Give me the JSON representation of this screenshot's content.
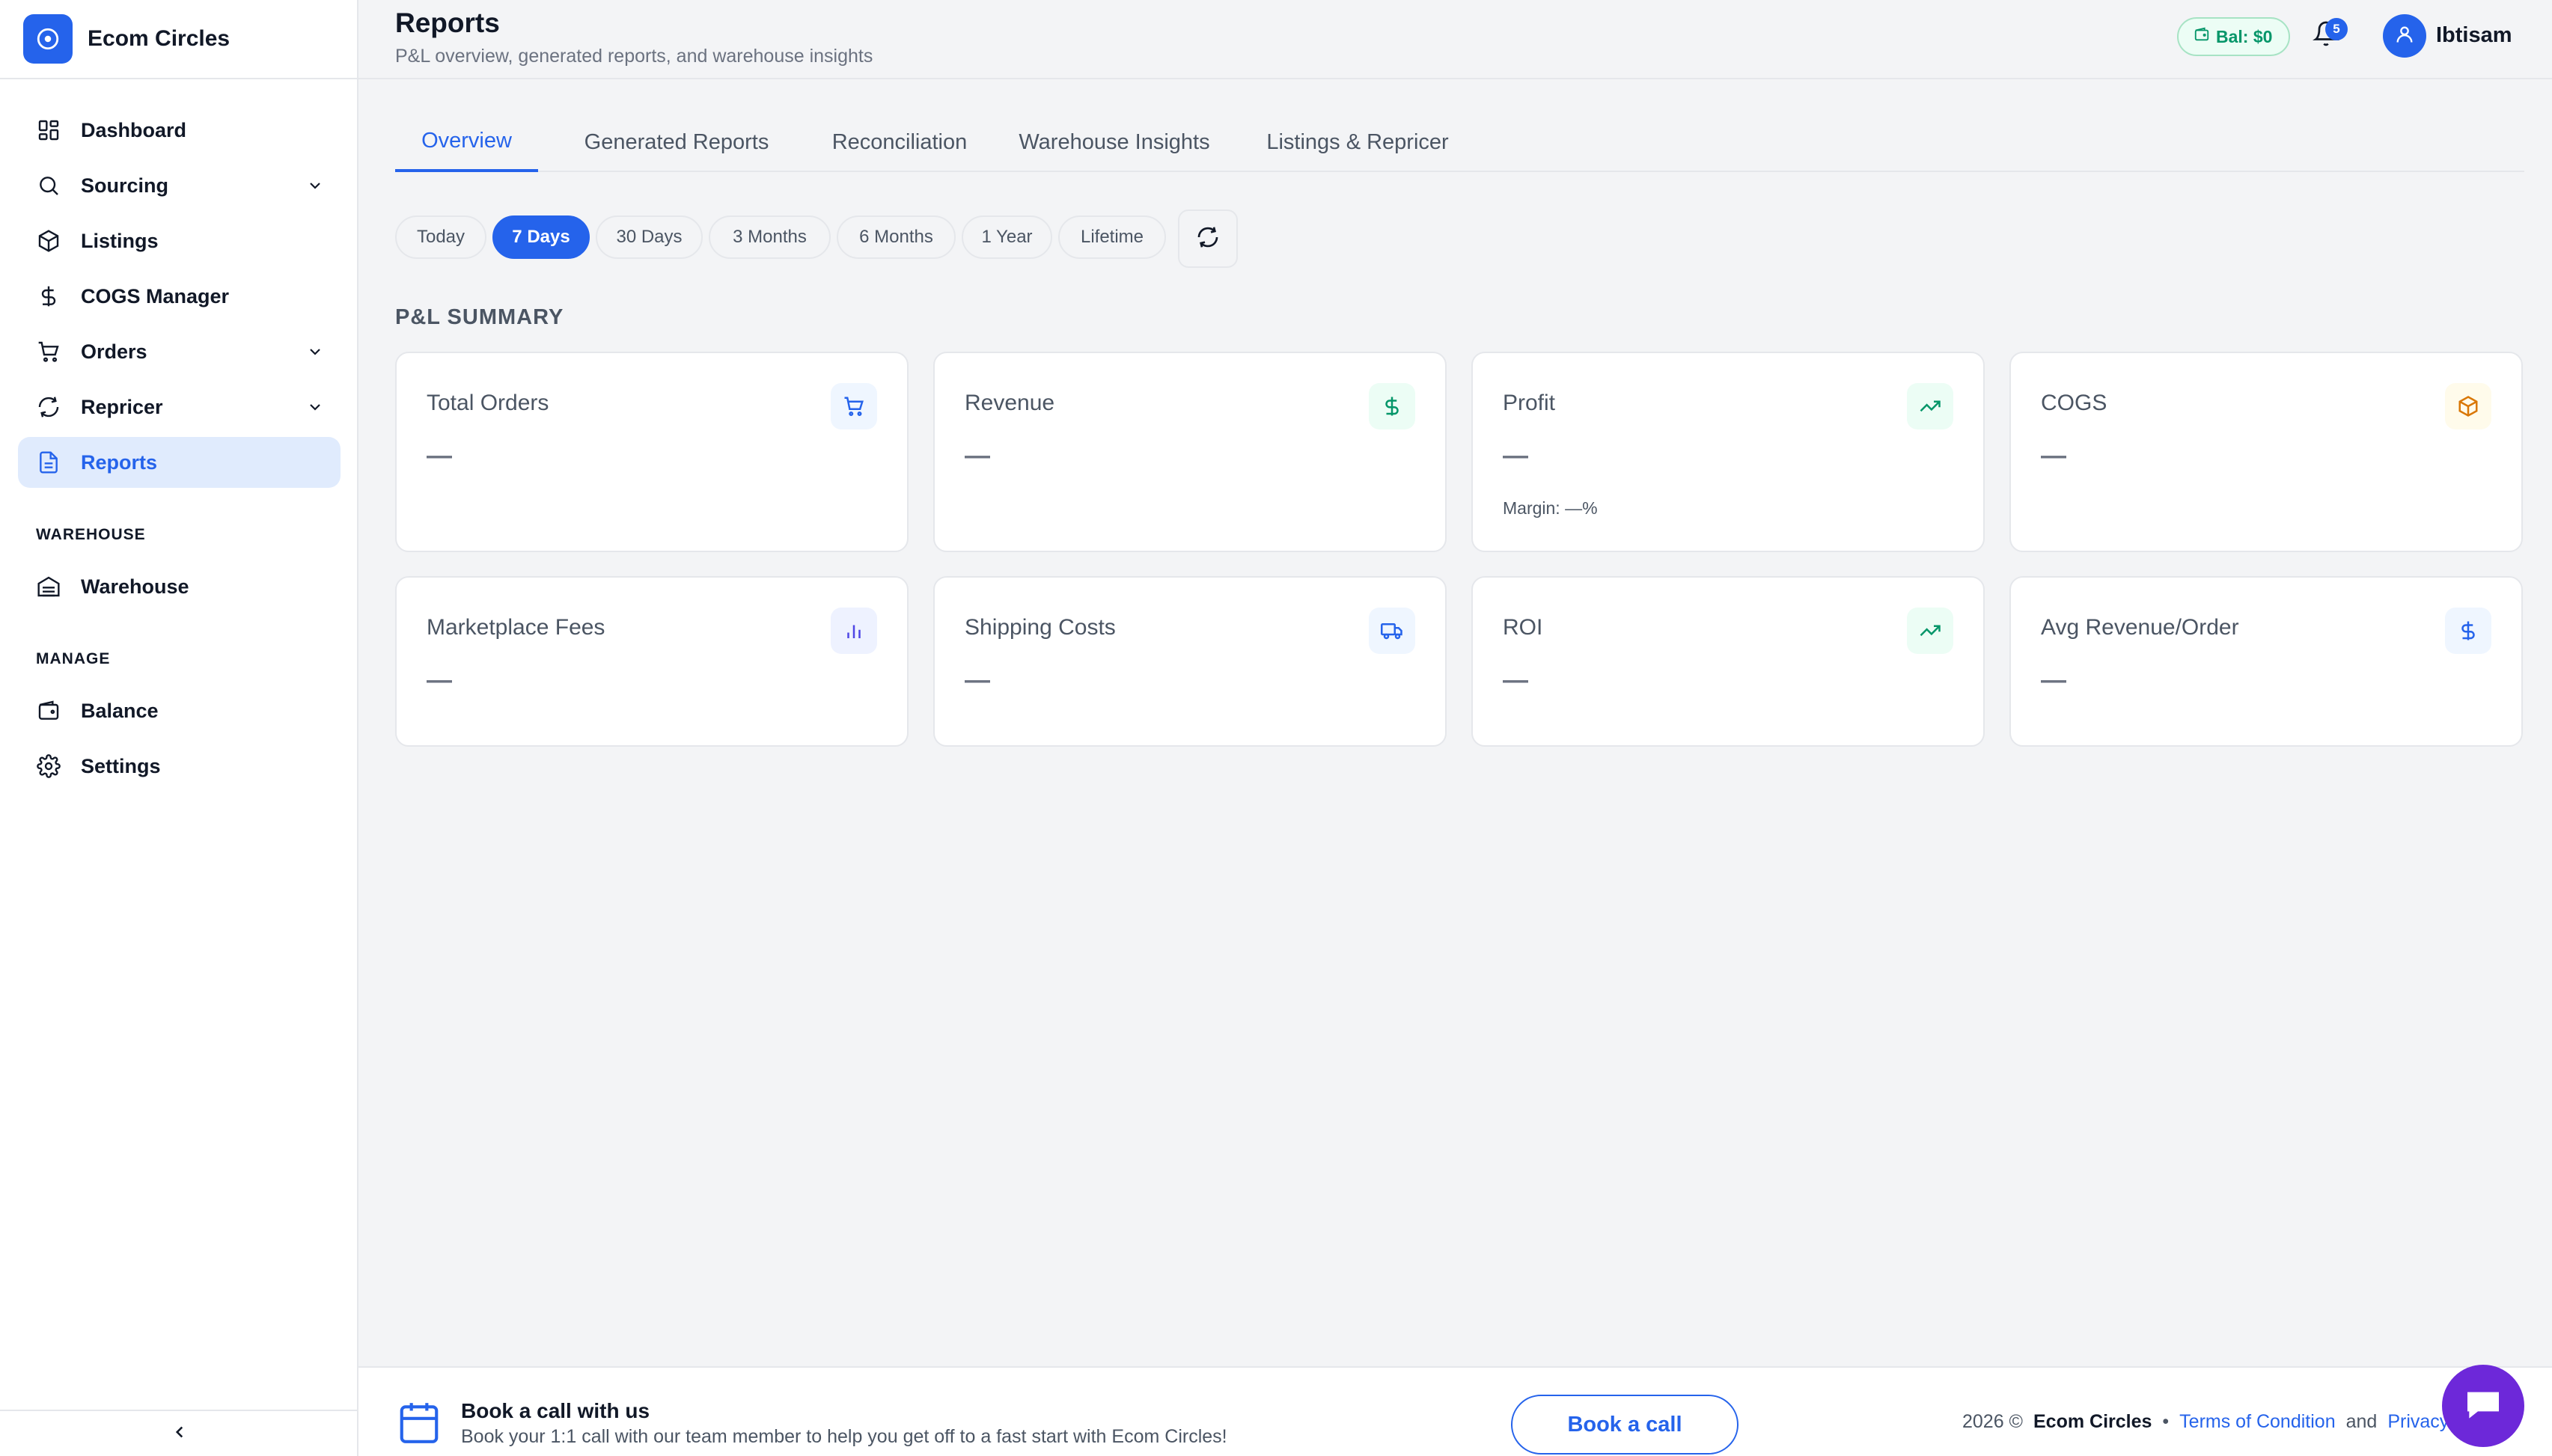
{
  "brand": {
    "name": "Ecom Circles"
  },
  "sidebar": {
    "items": [
      {
        "label": "Dashboard"
      },
      {
        "label": "Sourcing"
      },
      {
        "label": "Listings"
      },
      {
        "label": "COGS Manager"
      },
      {
        "label": "Orders"
      },
      {
        "label": "Repricer"
      },
      {
        "label": "Reports"
      }
    ],
    "warehouse_section": {
      "title": "WAREHOUSE",
      "items": [
        {
          "label": "Warehouse"
        }
      ]
    },
    "manage_section": {
      "title": "MANAGE",
      "items": [
        {
          "label": "Balance"
        },
        {
          "label": "Settings"
        }
      ]
    }
  },
  "header": {
    "title": "Reports",
    "subtitle": "P&L overview, generated reports, and warehouse insights",
    "balance": "Bal: $0",
    "notification_count": "5",
    "username": "Ibtisam"
  },
  "tabs": [
    {
      "label": "Overview"
    },
    {
      "label": "Generated Reports"
    },
    {
      "label": "Reconciliation"
    },
    {
      "label": "Warehouse Insights"
    },
    {
      "label": "Listings & Repricer"
    }
  ],
  "ranges": [
    {
      "label": "Today"
    },
    {
      "label": "7 Days"
    },
    {
      "label": "30 Days"
    },
    {
      "label": "3 Months"
    },
    {
      "label": "6 Months"
    },
    {
      "label": "1 Year"
    },
    {
      "label": "Lifetime"
    }
  ],
  "summary": {
    "heading": "P&L SUMMARY",
    "cards": [
      {
        "label": "Total Orders",
        "value": "—",
        "icon": "cart-icon",
        "color": "#2563eb"
      },
      {
        "label": "Revenue",
        "value": "—",
        "icon": "dollar-icon",
        "color": "#059669"
      },
      {
        "label": "Profit",
        "value": "—",
        "sub": "Margin: —%",
        "icon": "trending-up-icon",
        "color": "#059669"
      },
      {
        "label": "COGS",
        "value": "—",
        "icon": "package-icon",
        "color": "#d97706"
      },
      {
        "label": "Marketplace Fees",
        "value": "—",
        "icon": "bar-chart-icon",
        "color": "#4f46e5"
      },
      {
        "label": "Shipping Costs",
        "value": "—",
        "icon": "truck-icon",
        "color": "#2563eb"
      },
      {
        "label": "ROI",
        "value": "—",
        "icon": "trending-up-icon",
        "color": "#059669"
      },
      {
        "label": "Avg Revenue/Order",
        "value": "—",
        "icon": "dollar-icon",
        "color": "#2563eb"
      }
    ]
  },
  "footer": {
    "book_title": "Book a call with us",
    "book_desc": "Book your 1:1 call with our team member to help you get off to a fast start with Ecom Circles!",
    "book_button": "Book a call",
    "copyright": "2026 ©",
    "brand": "Ecom Circles",
    "bullet": "•",
    "terms": "Terms of Condition",
    "and": "and",
    "privacy": "Privacy Policy"
  },
  "colors": {
    "accent": "#2563eb",
    "success": "#059669",
    "warning": "#d97706",
    "chat": "#6d28d9"
  }
}
